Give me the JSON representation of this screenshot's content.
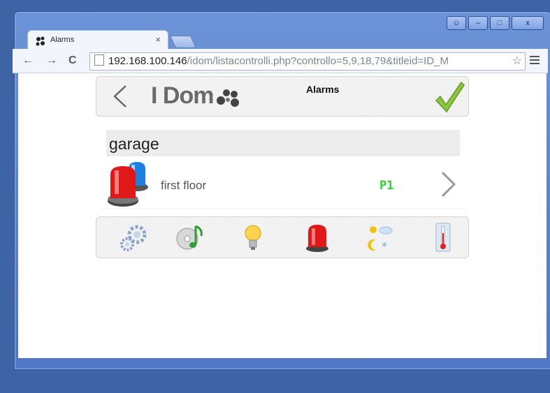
{
  "browser": {
    "tab_title": "Alarms",
    "tab_close": "×",
    "url_host": "192.168.100.146",
    "url_path": "/idom/listacontrolli.php?controllo=5,9,18,79&titleid=ID_M",
    "nav": {
      "back": "←",
      "forward": "→",
      "reload": "C"
    },
    "star": "☆"
  },
  "header": {
    "logo": "I Dom",
    "title": "Alarms"
  },
  "group": {
    "name": "garage"
  },
  "rows": [
    {
      "label": "first floor",
      "code": "P1"
    }
  ],
  "iconbar": {
    "icons": [
      "gears-icon",
      "music-cd-icon",
      "lightbulb-icon",
      "alarm-siren-icon",
      "weather-icon",
      "thermometer-icon"
    ]
  },
  "colors": {
    "code": "#2bd62b",
    "chrome_blue": "#5a82cc"
  }
}
